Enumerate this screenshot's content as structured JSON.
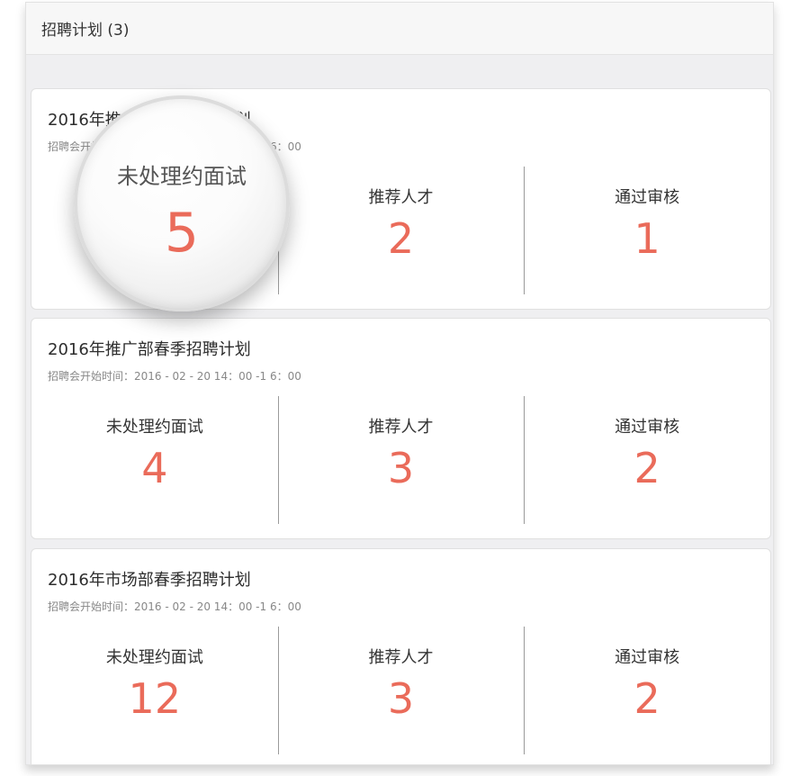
{
  "header": {
    "title": "招聘计划 (3)"
  },
  "plans": [
    {
      "title": "2016年推广部春季招聘计划",
      "time": "招聘会开始时间：2016 - 02 - 20  14：00 -1 6：00",
      "stats": [
        {
          "label": "未处理约面试",
          "value": "5"
        },
        {
          "label": "推荐人才",
          "value": "2"
        },
        {
          "label": "通过审核",
          "value": "1"
        }
      ]
    },
    {
      "title": "2016年推广部春季招聘计划",
      "time": "招聘会开始时间：2016 - 02 - 20  14：00 -1 6：00",
      "stats": [
        {
          "label": "未处理约面试",
          "value": "4"
        },
        {
          "label": "推荐人才",
          "value": "3"
        },
        {
          "label": "通过审核",
          "value": "2"
        }
      ]
    },
    {
      "title": "2016年市场部春季招聘计划",
      "time": "招聘会开始时间：2016 - 02 - 20  14：00 -1 6：00",
      "stats": [
        {
          "label": "未处理约面试",
          "value": "12"
        },
        {
          "label": "推荐人才",
          "value": "3"
        },
        {
          "label": "通过审核",
          "value": "2"
        }
      ]
    }
  ],
  "magnifier": {
    "label": "未处理约面试",
    "value": "5"
  },
  "colors": {
    "accent": "#ea6b5a",
    "background": "#efeff1",
    "divider": "#9a9a9a"
  }
}
